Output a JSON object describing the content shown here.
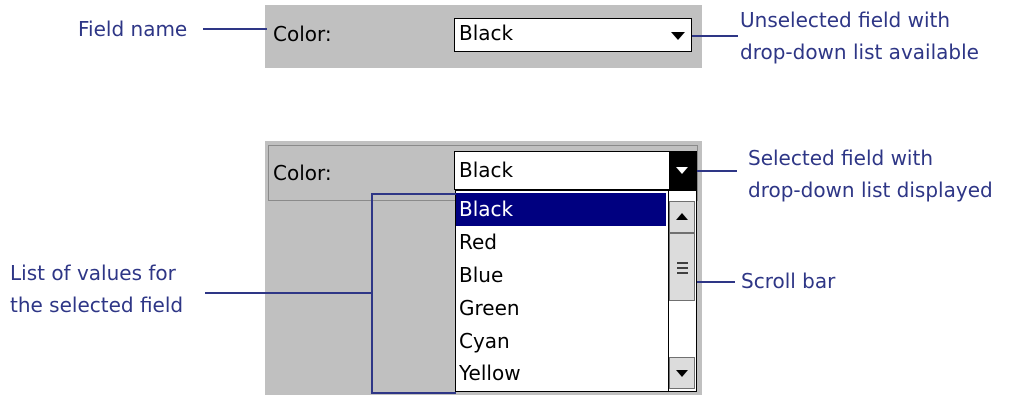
{
  "callouts": {
    "field_name": "Field name",
    "unselected": [
      "Unselected field with",
      "drop-down list available"
    ],
    "selected": [
      "Selected field with",
      "drop-down list displayed"
    ],
    "list_values": [
      "List of values for",
      "the selected field"
    ],
    "scroll_bar": "Scroll bar"
  },
  "top_field": {
    "label": "Color:",
    "value": "Black"
  },
  "bottom_field": {
    "label": "Color:",
    "value": "Black",
    "options": [
      "Black",
      "Red",
      "Blue",
      "Green",
      "Cyan",
      "Yellow"
    ],
    "selected_option": "Black"
  },
  "colors": {
    "callout_text": "#2e3686",
    "panel_bg": "#c0c0c0",
    "selection_bg": "#000080"
  },
  "icons": [
    "dropdown-arrow-icon",
    "scroll-up-icon",
    "scroll-down-icon",
    "scroll-thumb-grip-icon"
  ]
}
